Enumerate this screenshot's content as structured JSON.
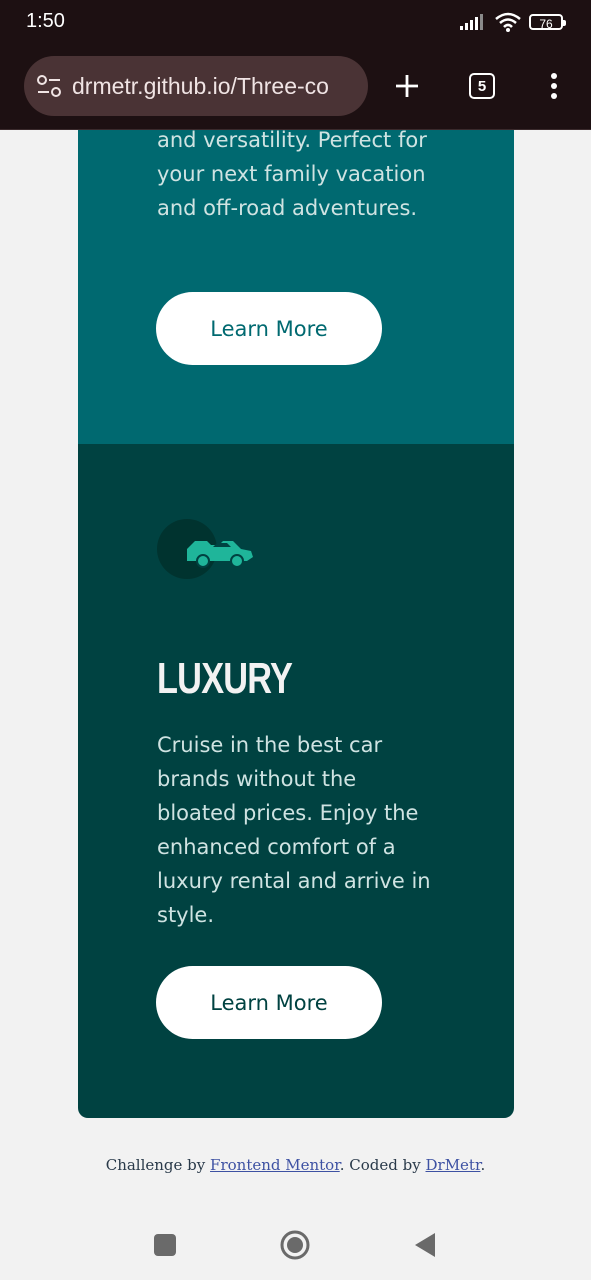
{
  "status": {
    "time": "1:50",
    "battery": "76"
  },
  "browser": {
    "url": "drmetr.github.io/Three-co",
    "tab_count": "5"
  },
  "card_suv": {
    "text": "and versatility. Perfect for your next family vacation and off-road adventures.",
    "button": "Learn More"
  },
  "card_luxury": {
    "title": "LUXURY",
    "text": "Cruise in the best car brands without the bloated prices. Enjoy the enhanced comfort of a luxury rental and arrive in style.",
    "button": "Learn More"
  },
  "footer": {
    "prefix": "Challenge by",
    "link1": "Frontend Mentor",
    "middle": ". Coded by",
    "link2": "DrMetr",
    "suffix": "."
  },
  "colors": {
    "teal": "#006970",
    "dark_cyan": "#004241",
    "accent": "#1fb59a",
    "page_bg": "#f2f2f2"
  },
  "icons": [
    "signal-icon",
    "wifi-icon",
    "battery-icon",
    "site-settings-icon",
    "new-tab-icon",
    "tabs-icon",
    "menu-icon",
    "car-icon",
    "recent-apps-icon",
    "home-icon",
    "back-icon"
  ]
}
